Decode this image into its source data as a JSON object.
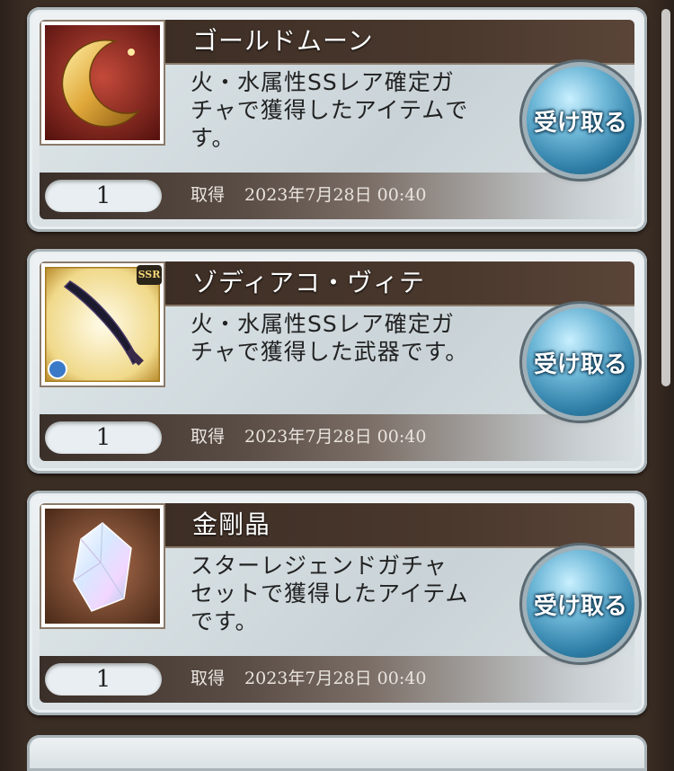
{
  "items": [
    {
      "name": "ゴールドムーン",
      "desc_lines": [
        "火・水属性SSレア確定ガ",
        "チャで獲得したアイテムで",
        "す。"
      ],
      "quantity": "1",
      "acquired_label": "取得",
      "acquired_date": "2023年7月28日 00:40",
      "receive_label": "受け取る",
      "icon": "gold-moon-icon"
    },
    {
      "name": "ゾディアコ・ヴィテ",
      "desc_lines": [
        "火・水属性SSレア確定ガ",
        "チャで獲得した武器です。",
        ""
      ],
      "quantity": "1",
      "acquired_label": "取得",
      "acquired_date": "2023年7月28日 00:40",
      "receive_label": "受け取る",
      "icon": "dagger-weapon-icon",
      "rarity_badge": "SSR"
    },
    {
      "name": "金剛晶",
      "desc_lines": [
        "スターレジェンドガチャ",
        "セットで獲得したアイテム",
        "です。"
      ],
      "quantity": "1",
      "acquired_label": "取得",
      "acquired_date": "2023年7月28日 00:40",
      "receive_label": "受け取る",
      "icon": "crystal-icon"
    }
  ],
  "colors": {
    "title_bar": "#3d2e25",
    "receive_button": "#2f7fa8",
    "card_bg": "#dfe7ea"
  }
}
